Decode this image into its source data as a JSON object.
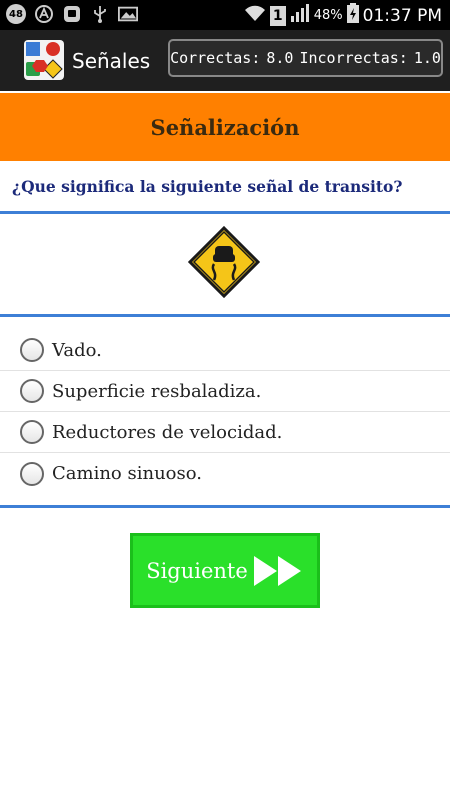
{
  "status_bar": {
    "notification_count": "48",
    "battery_percent": "48%",
    "sim_label": "1",
    "time": "01:37 PM",
    "icons": [
      "notification-count-icon",
      "a-circle-icon",
      "app-square-icon",
      "usb-icon",
      "image-icon",
      "wifi-icon",
      "sim-icon",
      "signal-icon",
      "battery-icon"
    ]
  },
  "app_bar": {
    "title": "Señales",
    "score": {
      "correct_label": "Correctas:",
      "correct_value": "8.0",
      "incorrect_label": "Incorrectas:",
      "incorrect_value": "1.0"
    }
  },
  "header": {
    "title": "Señalización"
  },
  "question": {
    "text": "¿Que significa la siguiente señal de transito?"
  },
  "sign": {
    "icon": "slippery-road-sign-icon",
    "color": "#f5c518"
  },
  "options": [
    {
      "label": "Vado."
    },
    {
      "label": "Superficie resbaladiza."
    },
    {
      "label": "Reductores de velocidad."
    },
    {
      "label": "Camino sinuoso."
    }
  ],
  "next_button": {
    "label": "Siguiente",
    "icon": "fast-forward-icon"
  },
  "colors": {
    "header_orange": "#ff8000",
    "question_blue": "#1c2a7a",
    "divider_blue": "#3d7fd6",
    "button_green": "#2ae02a"
  }
}
